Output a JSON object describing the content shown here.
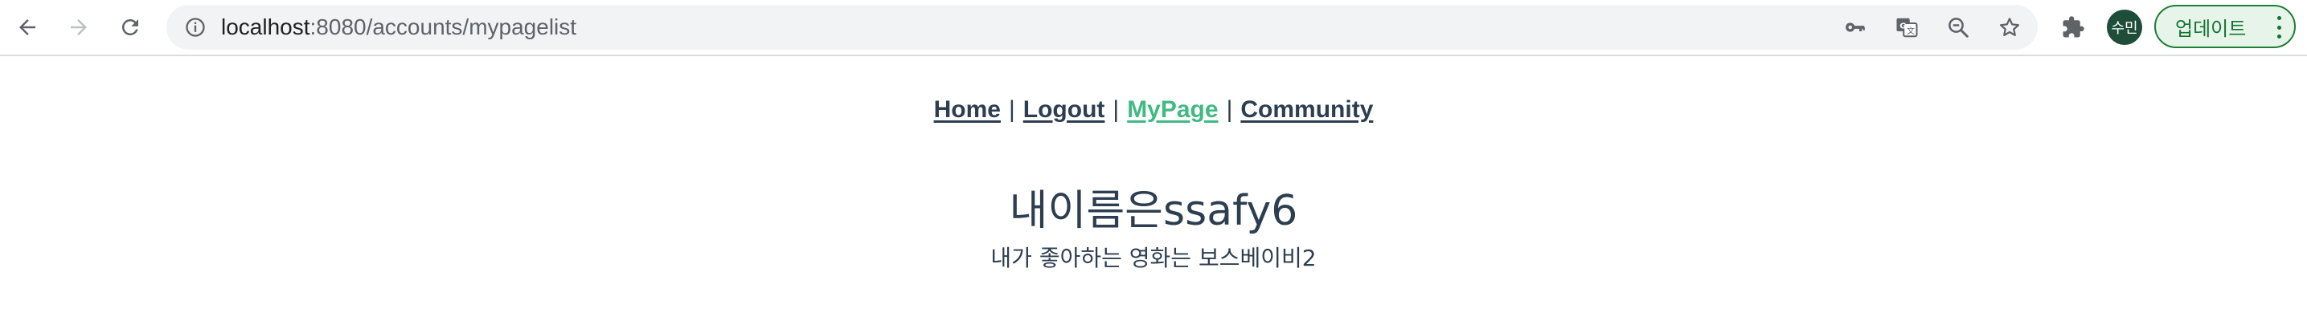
{
  "browser": {
    "url_host": "localhost",
    "url_path": ":8080/accounts/mypagelist",
    "profile_initials": "수민",
    "update_label": "업데이트",
    "accent_color": "#137333"
  },
  "nav": {
    "items": [
      {
        "label": "Home",
        "active": false
      },
      {
        "label": "Logout",
        "active": false
      },
      {
        "label": "MyPage",
        "active": true
      },
      {
        "label": "Community",
        "active": false
      }
    ],
    "separator": "|",
    "active_color": "#42b983",
    "text_color": "#2c3e50"
  },
  "main": {
    "title": "내이름은ssafy6",
    "subtitle": "내가 좋아하는 영화는 보스베이비2"
  },
  "icons": {
    "back": "back-arrow-icon",
    "forward": "forward-arrow-icon",
    "reload": "reload-icon",
    "site_info": "info-icon",
    "password": "key-icon",
    "translate": "translate-icon",
    "zoom": "zoom-out-icon",
    "bookmark": "star-icon",
    "extensions": "puzzle-icon",
    "menu": "more-vertical-icon"
  }
}
